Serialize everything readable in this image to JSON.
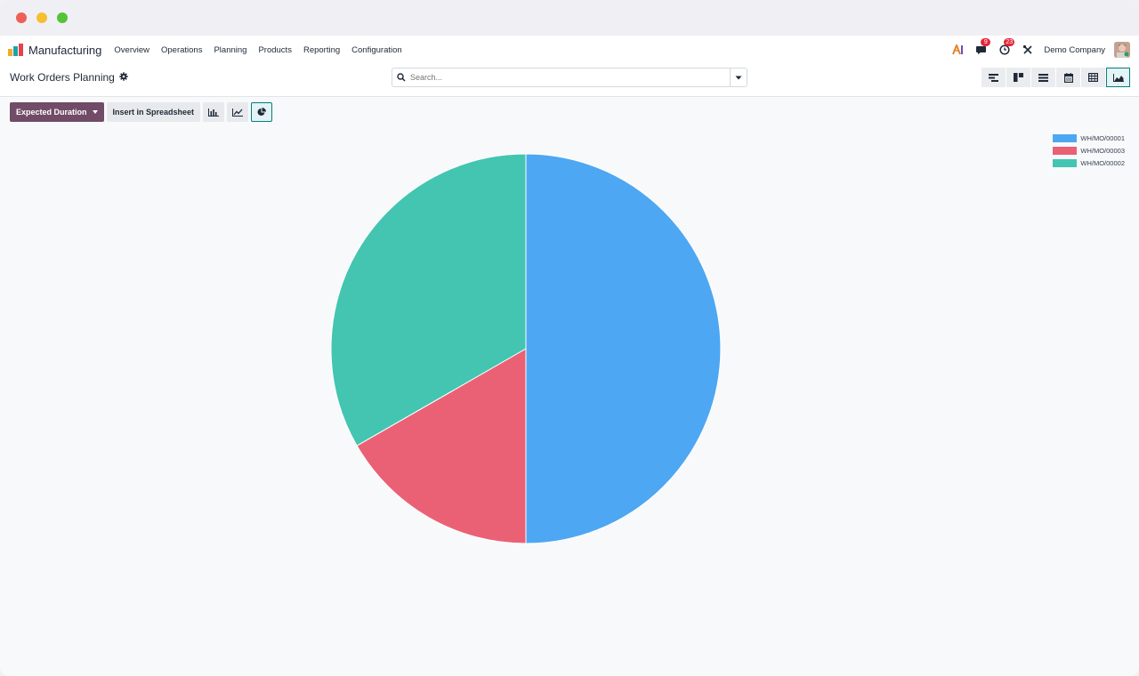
{
  "window": {
    "controls": [
      "close",
      "minimize",
      "maximize"
    ]
  },
  "navbar": {
    "app_name": "Manufacturing",
    "menu": [
      "Overview",
      "Operations",
      "Planning",
      "Products",
      "Reporting",
      "Configuration"
    ],
    "messages_badge": "9",
    "activities_badge": "23",
    "company": "Demo Company"
  },
  "control_panel": {
    "title": "Work Orders Planning",
    "search_placeholder": "Search...",
    "views": [
      "gantt",
      "kanban",
      "list",
      "calendar",
      "pivot",
      "graph"
    ],
    "active_view": "graph"
  },
  "toolbar": {
    "measure_label": "Expected Duration",
    "insert_label": "Insert in Spreadsheet",
    "active_chart_type": "pie"
  },
  "colors": {
    "brand": "#714b67",
    "accent": "#017e84"
  },
  "chart_data": {
    "type": "pie",
    "title": "",
    "categories": [
      "WH/MO/00001",
      "WH/MO/00003",
      "WH/MO/00002"
    ],
    "values": [
      50,
      16.7,
      33.3
    ],
    "colors": [
      "#4ea7f2",
      "#ea6175",
      "#43c5b1"
    ],
    "legend_position": "top-right"
  }
}
